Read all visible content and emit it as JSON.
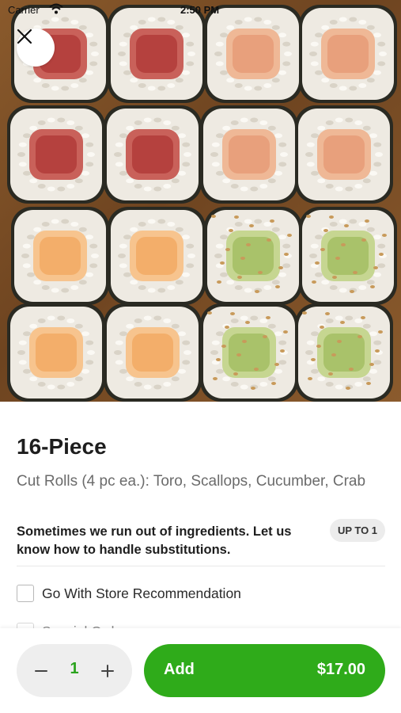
{
  "status_bar": {
    "carrier": "Carrier",
    "time": "2:50 PM"
  },
  "hero": {
    "alt_icon": "sushi-photo",
    "rolls": [
      "toro",
      "toro",
      "crab",
      "crab",
      "toro",
      "toro",
      "crab",
      "crab",
      "scallop",
      "scallop",
      "cucumber",
      "cucumber",
      "scallop",
      "scallop",
      "cucumber",
      "cucumber"
    ]
  },
  "close_icon": "close-icon",
  "item": {
    "title": "16-Piece",
    "description": "Cut Rolls (4 pc ea.): Toro, Scallops, Cucumber, Crab"
  },
  "substitutions": {
    "title": "Sometimes we run out of ingredients. Let us know how to handle substitutions.",
    "badge": "UP TO 1",
    "options": [
      {
        "label": "Go With Store Recommendation",
        "checked": false
      },
      {
        "label": "Special Order",
        "checked": false
      }
    ]
  },
  "bottom": {
    "quantity": "1",
    "add_label": "Add",
    "price": "$17.00"
  },
  "colors": {
    "accent": "#2fab1a",
    "quantity_text": "#2aa31d",
    "badge_bg": "#ececec",
    "stepper_bg": "#eeeeee"
  }
}
